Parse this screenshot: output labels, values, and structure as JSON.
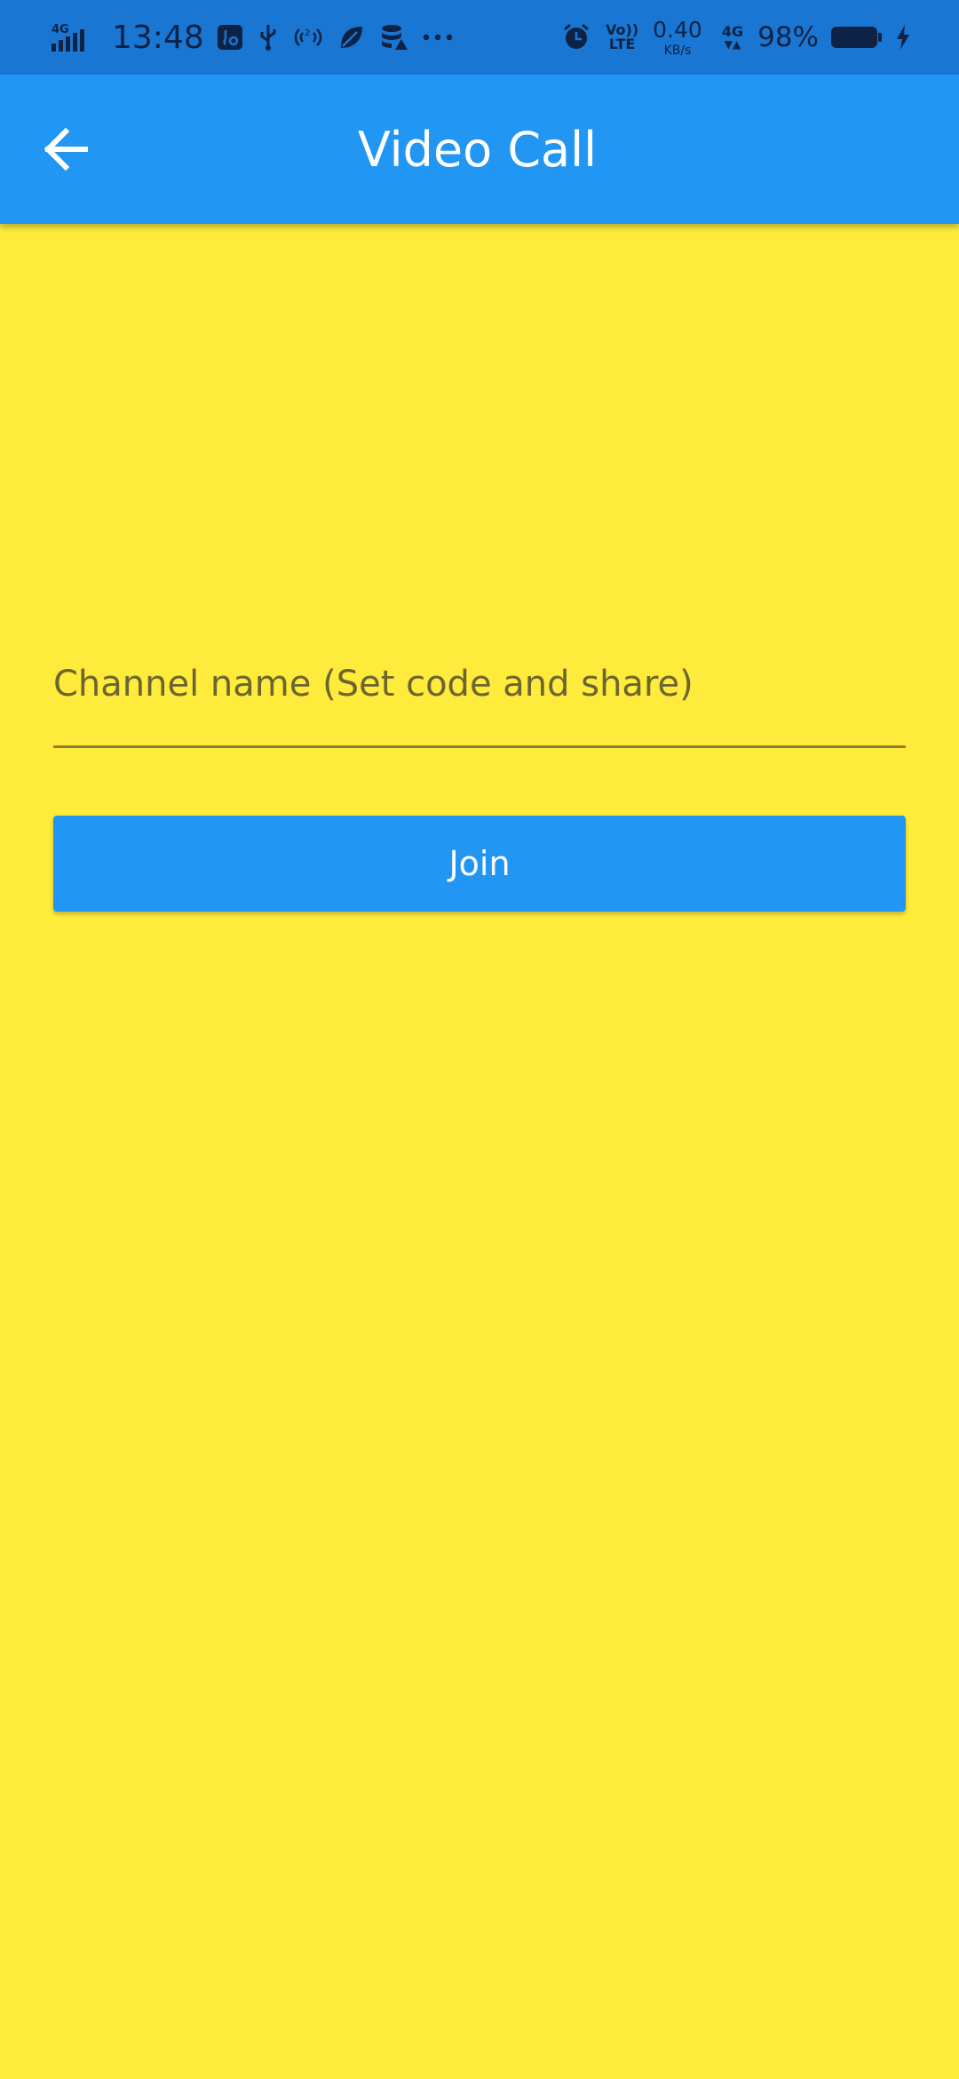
{
  "status_bar": {
    "network_type": "4G",
    "time": "13:48",
    "volte_label": "VoLTE",
    "speed_value": "0.40",
    "speed_unit": "KB/s",
    "network_type_2": "4G",
    "battery_percent": "98%",
    "icons": [
      "signal-icon",
      "usb-debug-icon",
      "usb-icon",
      "hotspot-icon",
      "leaf-icon",
      "data-saver-icon",
      "more-dots-icon",
      "alarm-icon",
      "volte-icon",
      "network-4g-icon",
      "battery-icon",
      "charging-icon"
    ]
  },
  "app_bar": {
    "title": "Video Call",
    "back_icon": "arrow-back-icon"
  },
  "form": {
    "channel_placeholder": "Channel name (Set code and share)",
    "channel_value": "",
    "join_label": "Join"
  },
  "colors": {
    "status_bar_bg": "#1976D2",
    "app_bar_bg": "#2196F3",
    "page_bg": "#FFEB3B",
    "button_bg": "#2196F3",
    "button_text": "#FFFFFF"
  }
}
